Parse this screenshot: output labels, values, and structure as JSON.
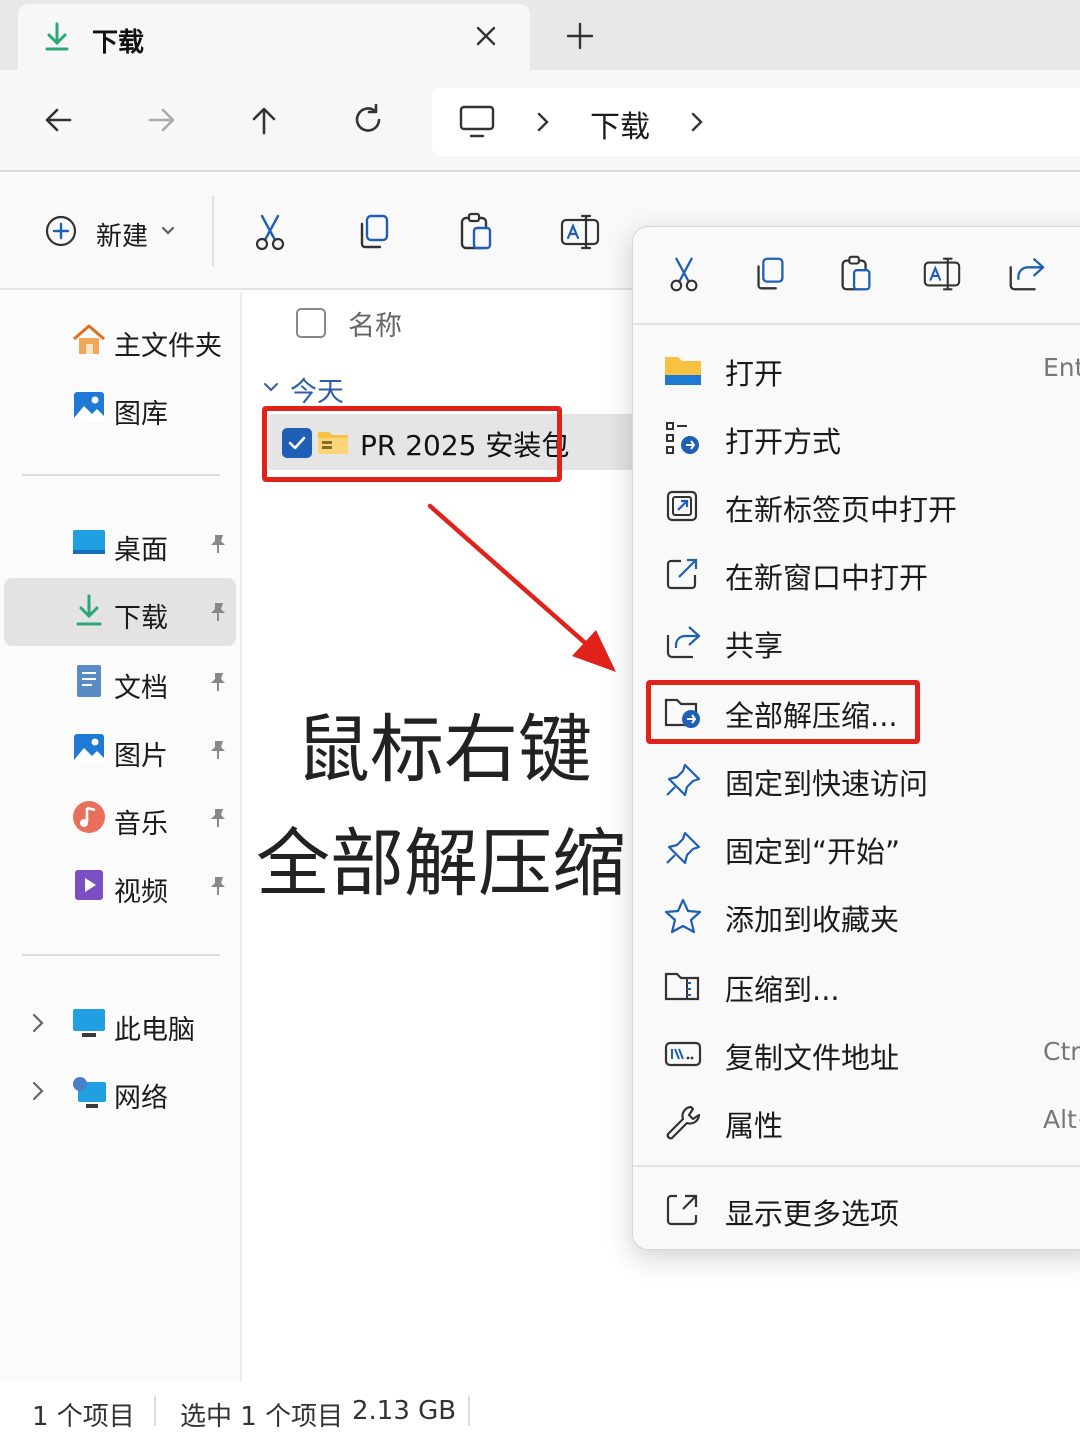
{
  "tab": {
    "title": "下载"
  },
  "address": {
    "crumb": "下载"
  },
  "command_bar": {
    "new_label": "新建"
  },
  "sidebar": {
    "items": [
      {
        "label": "主文件夹"
      },
      {
        "label": "图库"
      },
      {
        "label": "桌面"
      },
      {
        "label": "下载"
      },
      {
        "label": "文档"
      },
      {
        "label": "图片"
      },
      {
        "label": "音乐"
      },
      {
        "label": "视频"
      },
      {
        "label": "此电脑"
      },
      {
        "label": "网络"
      }
    ],
    "active": "下载"
  },
  "file_list": {
    "column_name": "名称",
    "group_label": "今天",
    "files": [
      {
        "name": "PR 2025 安装包",
        "selected": true
      }
    ]
  },
  "annotation": {
    "line1": "鼠标右键",
    "line2": "全部解压缩"
  },
  "context_menu": {
    "items": [
      {
        "label": "打开",
        "shortcut": "Ente"
      },
      {
        "label": "打开方式",
        "shortcut": ""
      },
      {
        "label": "在新标签页中打开",
        "shortcut": ""
      },
      {
        "label": "在新窗口中打开",
        "shortcut": ""
      },
      {
        "label": "共享",
        "shortcut": ""
      },
      {
        "label": "全部解压缩...",
        "shortcut": ""
      },
      {
        "label": "固定到快速访问",
        "shortcut": ""
      },
      {
        "label": "固定到“开始”",
        "shortcut": ""
      },
      {
        "label": "添加到收藏夹",
        "shortcut": ""
      },
      {
        "label": "压缩到...",
        "shortcut": ""
      },
      {
        "label": "复制文件地址",
        "shortcut": "Ctrl"
      },
      {
        "label": "属性",
        "shortcut": "Alt+"
      },
      {
        "label": "显示更多选项",
        "shortcut": ""
      }
    ]
  },
  "status_bar": {
    "count": "1 个项目",
    "selected": "选中 1 个项目",
    "size": "2.13 GB"
  },
  "colors": {
    "accent": "#1f5fb5",
    "highlight": "#e0221a",
    "folder": "#f5c242"
  }
}
